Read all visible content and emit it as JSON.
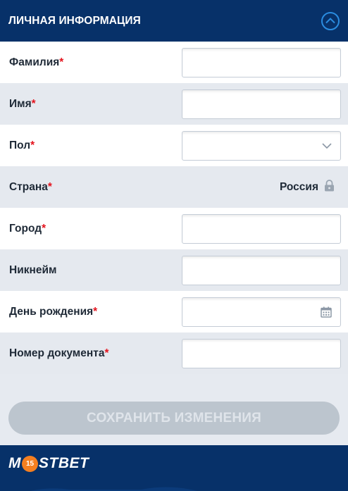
{
  "section": {
    "title": "ЛИЧНАЯ ИНФОРМАЦИЯ",
    "collapse_icon": "chevron-up-icon"
  },
  "required_mark": "*",
  "fields": {
    "surname": {
      "label": "Фамилия",
      "value": ""
    },
    "name": {
      "label": "Имя",
      "value": ""
    },
    "gender": {
      "label": "Пол",
      "value": ""
    },
    "country": {
      "label": "Страна",
      "value": "Россия",
      "icon": "lock-icon"
    },
    "city": {
      "label": "Город",
      "value": ""
    },
    "nickname": {
      "label": "Никнейм",
      "value": ""
    },
    "birthday": {
      "label": "День рождения",
      "value": "",
      "icon": "calendar-icon"
    },
    "document": {
      "label": "Номер документа",
      "value": ""
    }
  },
  "save_button": {
    "label": "СОХРАНИТЬ ИЗМЕНЕНИЯ"
  },
  "footer": {
    "logo_part1": "M",
    "logo_badge": "15",
    "logo_part2": "STBET"
  },
  "colors": {
    "header_bg": "#073169",
    "accent_blue": "#2a8ce0",
    "required_red": "#e4141e",
    "badge_orange": "#f57f20"
  }
}
